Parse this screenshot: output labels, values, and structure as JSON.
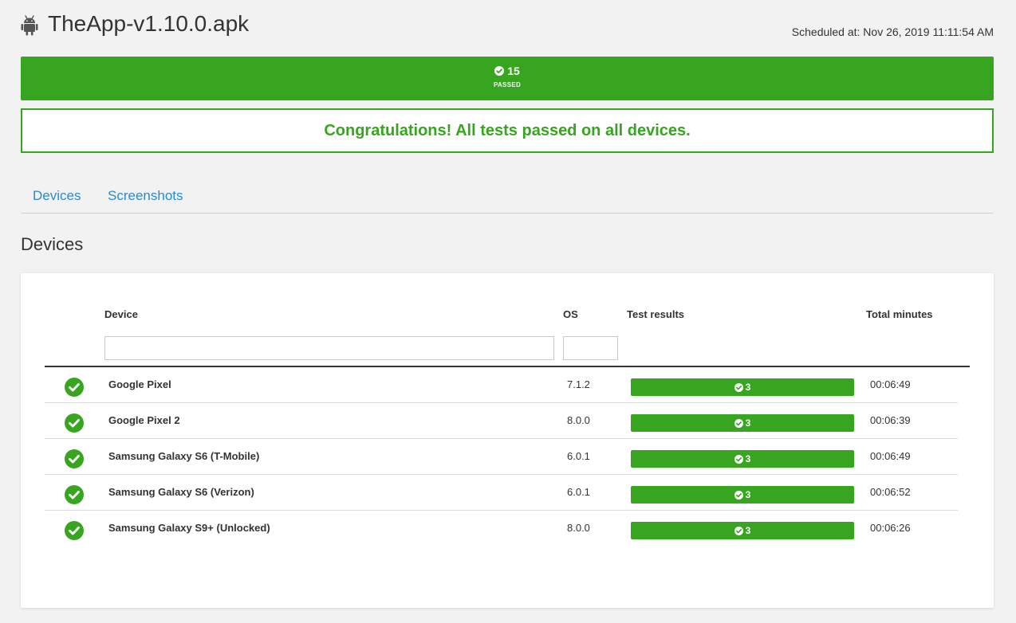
{
  "header": {
    "title": "TheApp-v1.10.0.apk",
    "platform_icon": "android-icon",
    "scheduled": "Scheduled at: Nov 26, 2019 11:11:54 AM"
  },
  "summary": {
    "passed_count": "15",
    "passed_label": "PASSED",
    "color": "#37a520"
  },
  "congrats": {
    "message": "Congratulations! All tests passed on all devices."
  },
  "tabs": [
    {
      "label": "Devices"
    },
    {
      "label": "Screenshots"
    }
  ],
  "section": {
    "title": "Devices"
  },
  "table": {
    "columns": {
      "device": "Device",
      "os": "OS",
      "results": "Test results",
      "minutes": "Total minutes"
    },
    "filters": {
      "device_value": "",
      "os_value": ""
    },
    "rows": [
      {
        "device": "Google Pixel",
        "os": "7.1.2",
        "passed": "3",
        "minutes": "00:06:49"
      },
      {
        "device": "Google Pixel 2",
        "os": "8.0.0",
        "passed": "3",
        "minutes": "00:06:39"
      },
      {
        "device": "Samsung Galaxy S6 (T-Mobile)",
        "os": "6.0.1",
        "passed": "3",
        "minutes": "00:06:49"
      },
      {
        "device": "Samsung Galaxy S6 (Verizon)",
        "os": "6.0.1",
        "passed": "3",
        "minutes": "00:06:52"
      },
      {
        "device": "Samsung Galaxy S9+ (Unlocked)",
        "os": "8.0.0",
        "passed": "3",
        "minutes": "00:06:26"
      }
    ]
  },
  "colors": {
    "accent_green": "#37a520",
    "link_blue": "#2a8bc9"
  }
}
